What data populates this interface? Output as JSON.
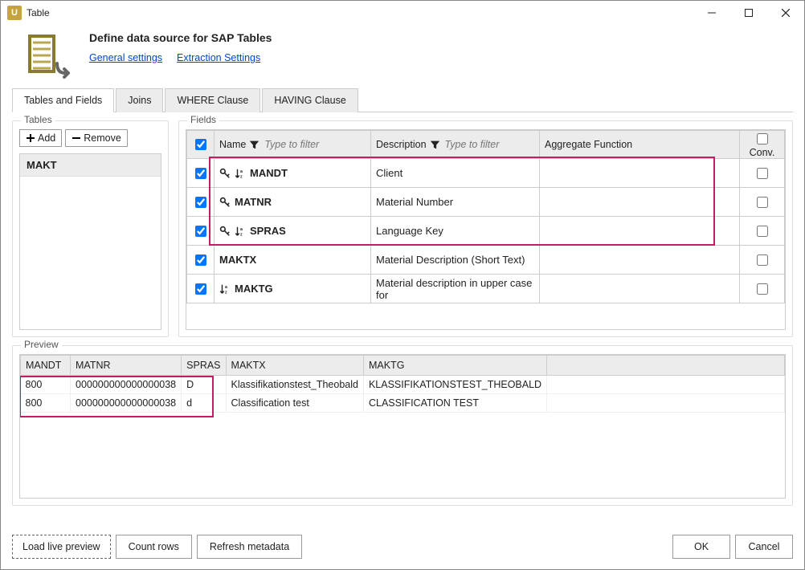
{
  "window": {
    "title": "Table"
  },
  "header": {
    "title": "Define data source for SAP Tables",
    "link_general": "General settings",
    "link_extraction": "Extraction Settings"
  },
  "tabs": {
    "t1": "Tables and Fields",
    "t2": "Joins",
    "t3": "WHERE Clause",
    "t4": "HAVING Clause"
  },
  "tables": {
    "group_title": "Tables",
    "add": "Add",
    "remove": "Remove",
    "items": [
      "MAKT"
    ]
  },
  "fields": {
    "group_title": "Fields",
    "header_name": "Name",
    "header_desc": "Description",
    "header_agg": "Aggregate Function",
    "header_conv": "Conv.",
    "filter_placeholder": "Type to filter",
    "rows": [
      {
        "name": "MANDT",
        "desc": "Client",
        "key": true,
        "sort": true,
        "checked": true,
        "hl": true
      },
      {
        "name": "MATNR",
        "desc": "Material Number",
        "key": true,
        "sort": false,
        "checked": true,
        "hl": true
      },
      {
        "name": "SPRAS",
        "desc": "Language Key",
        "key": true,
        "sort": true,
        "checked": true,
        "hl": true
      },
      {
        "name": "MAKTX",
        "desc": "Material Description (Short Text)",
        "key": false,
        "sort": false,
        "checked": true,
        "hl": false
      },
      {
        "name": "MAKTG",
        "desc": "Material description in upper case for",
        "key": false,
        "sort": true,
        "checked": true,
        "hl": false
      }
    ]
  },
  "preview": {
    "group_title": "Preview",
    "columns": [
      "MANDT",
      "MATNR",
      "SPRAS",
      "MAKTX",
      "MAKTG"
    ],
    "rows": [
      {
        "MANDT": "800",
        "MATNR": "000000000000000038",
        "SPRAS": "D",
        "MAKTX": "Klassifikationstest_Theobald",
        "MAKTG": "KLASSIFIKATIONSTEST_THEOBALD"
      },
      {
        "MANDT": "800",
        "MATNR": "000000000000000038",
        "SPRAS": "d",
        "MAKTX": "Classification test",
        "MAKTG": "CLASSIFICATION TEST"
      }
    ]
  },
  "footer": {
    "load": "Load live preview",
    "count": "Count rows",
    "refresh": "Refresh metadata",
    "ok": "OK",
    "cancel": "Cancel"
  }
}
